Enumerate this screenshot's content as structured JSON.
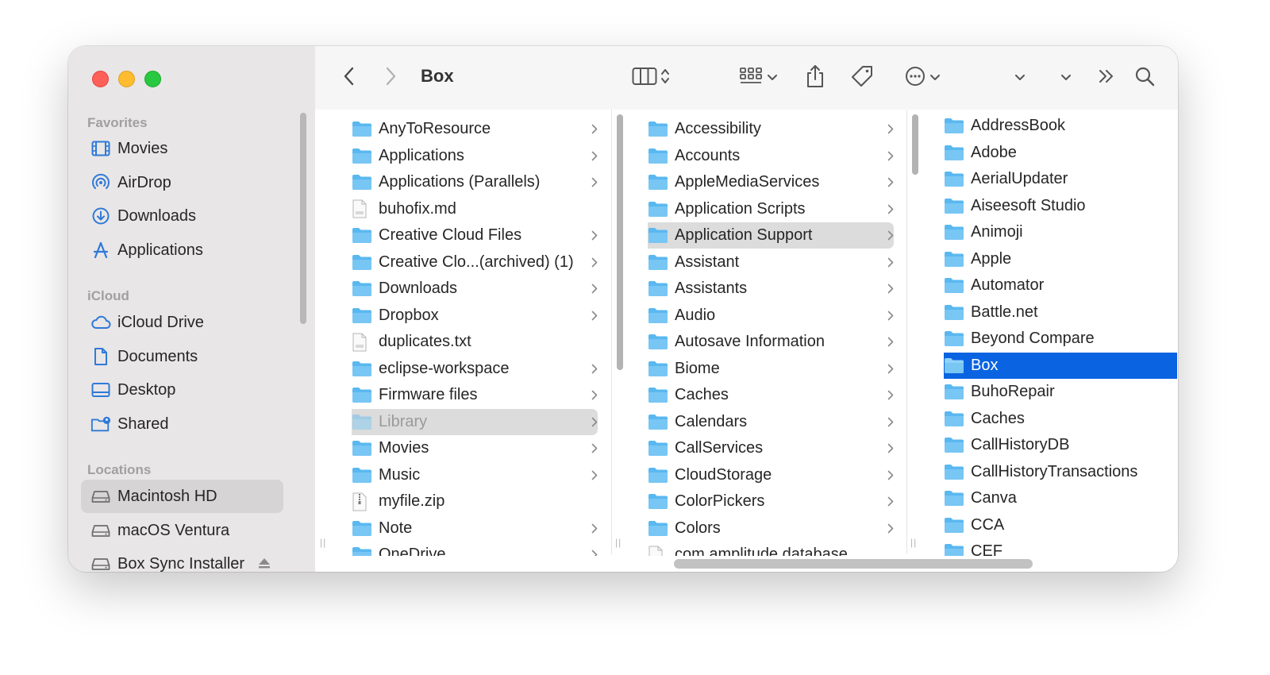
{
  "window": {
    "title": "Box"
  },
  "sidebar": {
    "sections": [
      {
        "label": "Favorites",
        "items": [
          {
            "label": "Movies",
            "icon": "film-icon"
          },
          {
            "label": "AirDrop",
            "icon": "airdrop-icon"
          },
          {
            "label": "Downloads",
            "icon": "download-icon"
          },
          {
            "label": "Applications",
            "icon": "applications-icon"
          }
        ]
      },
      {
        "label": "iCloud",
        "items": [
          {
            "label": "iCloud Drive",
            "icon": "cloud-icon"
          },
          {
            "label": "Documents",
            "icon": "document-icon"
          },
          {
            "label": "Desktop",
            "icon": "desktop-icon"
          },
          {
            "label": "Shared",
            "icon": "shared-folder-icon"
          }
        ]
      },
      {
        "label": "Locations",
        "items": [
          {
            "label": "Macintosh HD",
            "icon": "drive-icon",
            "selected": true
          },
          {
            "label": "macOS Ventura",
            "icon": "drive-icon"
          },
          {
            "label": "Box Sync Installer",
            "icon": "drive-icon",
            "eject": true
          }
        ]
      }
    ]
  },
  "toolbar": {
    "back_icon": "chevron-left-icon",
    "forward_icon": "chevron-right-icon",
    "view_icon": "column-view-icon",
    "group_icon": "grid-group-icon",
    "share_icon": "share-icon",
    "tag_icon": "tag-icon",
    "more_icon": "ellipsis-circle-icon",
    "overflow_icon": "double-chevron-icon",
    "search_icon": "search-icon"
  },
  "columns": [
    {
      "items": [
        {
          "name": "AnyToResource",
          "kind": "folder",
          "chevron": true
        },
        {
          "name": "Applications",
          "kind": "folder",
          "chevron": true
        },
        {
          "name": "Applications (Parallels)",
          "kind": "folder",
          "chevron": true
        },
        {
          "name": "buhofix.md",
          "kind": "file",
          "chevron": false
        },
        {
          "name": "Creative Cloud Files",
          "kind": "folder",
          "chevron": true
        },
        {
          "name": "Creative Clo...(archived) (1)",
          "kind": "folder",
          "chevron": true
        },
        {
          "name": "Downloads",
          "kind": "folder",
          "chevron": true
        },
        {
          "name": "Dropbox",
          "kind": "folder",
          "chevron": true
        },
        {
          "name": "duplicates.txt",
          "kind": "file",
          "chevron": false
        },
        {
          "name": "eclipse-workspace",
          "kind": "folder",
          "chevron": true
        },
        {
          "name": "Firmware files",
          "kind": "folder",
          "chevron": true
        },
        {
          "name": "Library",
          "kind": "folder",
          "chevron": true,
          "selected": "gray",
          "dim": true
        },
        {
          "name": "Movies",
          "kind": "folder",
          "chevron": true
        },
        {
          "name": "Music",
          "kind": "folder",
          "chevron": true
        },
        {
          "name": "myfile.zip",
          "kind": "zip",
          "chevron": false
        },
        {
          "name": "Note",
          "kind": "folder",
          "chevron": true
        },
        {
          "name": "OneDrive",
          "kind": "folder",
          "chevron": true
        }
      ]
    },
    {
      "items": [
        {
          "name": "Accessibility",
          "kind": "folder",
          "chevron": true
        },
        {
          "name": "Accounts",
          "kind": "folder",
          "chevron": true
        },
        {
          "name": "AppleMediaServices",
          "kind": "folder",
          "chevron": true
        },
        {
          "name": "Application Scripts",
          "kind": "folder",
          "chevron": true
        },
        {
          "name": "Application Support",
          "kind": "folder",
          "chevron": true,
          "selected": "gray"
        },
        {
          "name": "Assistant",
          "kind": "folder",
          "chevron": true
        },
        {
          "name": "Assistants",
          "kind": "folder",
          "chevron": true
        },
        {
          "name": "Audio",
          "kind": "folder",
          "chevron": true
        },
        {
          "name": "Autosave Information",
          "kind": "folder",
          "chevron": true
        },
        {
          "name": "Biome",
          "kind": "folder",
          "chevron": true
        },
        {
          "name": "Caches",
          "kind": "folder",
          "chevron": true
        },
        {
          "name": "Calendars",
          "kind": "folder",
          "chevron": true
        },
        {
          "name": "CallServices",
          "kind": "folder",
          "chevron": true
        },
        {
          "name": "CloudStorage",
          "kind": "folder",
          "chevron": true
        },
        {
          "name": "ColorPickers",
          "kind": "folder",
          "chevron": true
        },
        {
          "name": "Colors",
          "kind": "folder",
          "chevron": true
        },
        {
          "name": "com.amplitude.database",
          "kind": "file",
          "chevron": false
        }
      ]
    },
    {
      "items": [
        {
          "name": "AddressBook",
          "kind": "folder"
        },
        {
          "name": "Adobe",
          "kind": "folder"
        },
        {
          "name": "AerialUpdater",
          "kind": "folder"
        },
        {
          "name": "Aiseesoft Studio",
          "kind": "folder"
        },
        {
          "name": "Animoji",
          "kind": "folder"
        },
        {
          "name": "Apple",
          "kind": "folder"
        },
        {
          "name": "Automator",
          "kind": "folder"
        },
        {
          "name": "Battle.net",
          "kind": "folder"
        },
        {
          "name": "Beyond Compare",
          "kind": "folder"
        },
        {
          "name": "Box",
          "kind": "folder",
          "selected": "blue"
        },
        {
          "name": "BuhoRepair",
          "kind": "folder"
        },
        {
          "name": "Caches",
          "kind": "folder"
        },
        {
          "name": "CallHistoryDB",
          "kind": "folder"
        },
        {
          "name": "CallHistoryTransactions",
          "kind": "folder"
        },
        {
          "name": "Canva",
          "kind": "folder"
        },
        {
          "name": "CCA",
          "kind": "folder"
        },
        {
          "name": "CEF",
          "kind": "folder"
        }
      ]
    }
  ],
  "colors": {
    "accent": "#0a63e1",
    "folder": "#5ab8f0",
    "sidebar_icon": "#2f7ad8"
  }
}
